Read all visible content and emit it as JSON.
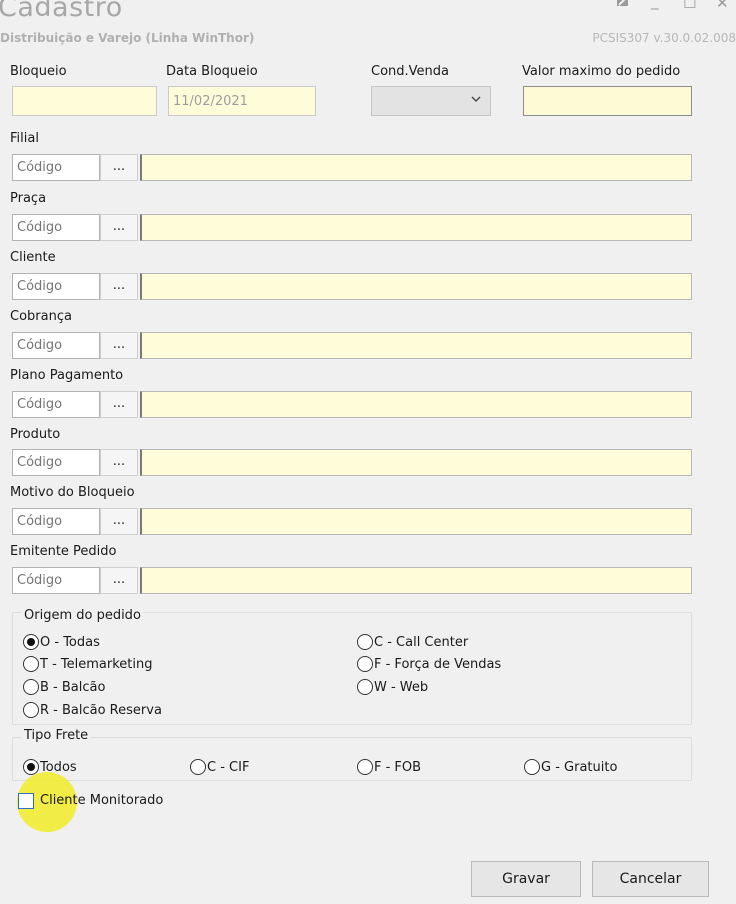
{
  "window": {
    "title": "Cadastro",
    "subtitle": "Distribuição e Varejo (Linha WinThor)",
    "version": "PCSIS307  v.30.0.02.008",
    "buttons": {
      "edit_icon": "edit-icon",
      "minimize": "_",
      "maximize": "☐",
      "close": "✕"
    }
  },
  "top_fields": {
    "bloqueio": {
      "label": "Bloqueio",
      "value": ""
    },
    "data_bloqueio": {
      "label": "Data Bloqueio",
      "value": "11/02/2021"
    },
    "cond_venda": {
      "label": "Cond.Venda",
      "value": ""
    },
    "valor_maximo": {
      "label": "Valor maximo do pedido",
      "value": ""
    }
  },
  "lookups": [
    {
      "label": "Filial",
      "code_placeholder": "Código",
      "button": "...",
      "description": ""
    },
    {
      "label": "Praça",
      "code_placeholder": "Código",
      "button": "...",
      "description": ""
    },
    {
      "label": "Cliente",
      "code_placeholder": "Código",
      "button": "...",
      "description": ""
    },
    {
      "label": "Cobrança",
      "code_placeholder": "Código",
      "button": "...",
      "description": ""
    },
    {
      "label": "Plano Pagamento",
      "code_placeholder": "Código",
      "button": "...",
      "description": ""
    },
    {
      "label": "Produto",
      "code_placeholder": "Código",
      "button": "...",
      "description": ""
    },
    {
      "label": "Motivo do Bloqueio",
      "code_placeholder": "Código",
      "button": "...",
      "description": ""
    },
    {
      "label": "Emitente Pedido",
      "code_placeholder": "Código",
      "button": "...",
      "description": ""
    }
  ],
  "origem": {
    "title": "Origem do pedido",
    "options": [
      {
        "label": "O - Todas",
        "selected": true
      },
      {
        "label": "T - Telemarketing",
        "selected": false
      },
      {
        "label": "B - Balcão",
        "selected": false
      },
      {
        "label": "R - Balcão Reserva",
        "selected": false
      },
      {
        "label": "C - Call Center",
        "selected": false
      },
      {
        "label": "F - Força de Vendas",
        "selected": false
      },
      {
        "label": "W - Web",
        "selected": false
      }
    ]
  },
  "frete": {
    "title": "Tipo Frete",
    "options": [
      {
        "label": "Todos",
        "selected": true
      },
      {
        "label": "C - CIF",
        "selected": false
      },
      {
        "label": "F - FOB",
        "selected": false
      },
      {
        "label": "G - Gratuito",
        "selected": false
      }
    ]
  },
  "cliente_monitorado": {
    "label": "Cliente Monitorado",
    "checked": false
  },
  "actions": {
    "save": "Gravar",
    "cancel": "Cancelar"
  },
  "colors": {
    "field_yellow": "#fffdd9",
    "background": "#f0f0f0",
    "checkbox_border": "#2b6fc2",
    "cursor_highlight": "#f2eb28"
  }
}
